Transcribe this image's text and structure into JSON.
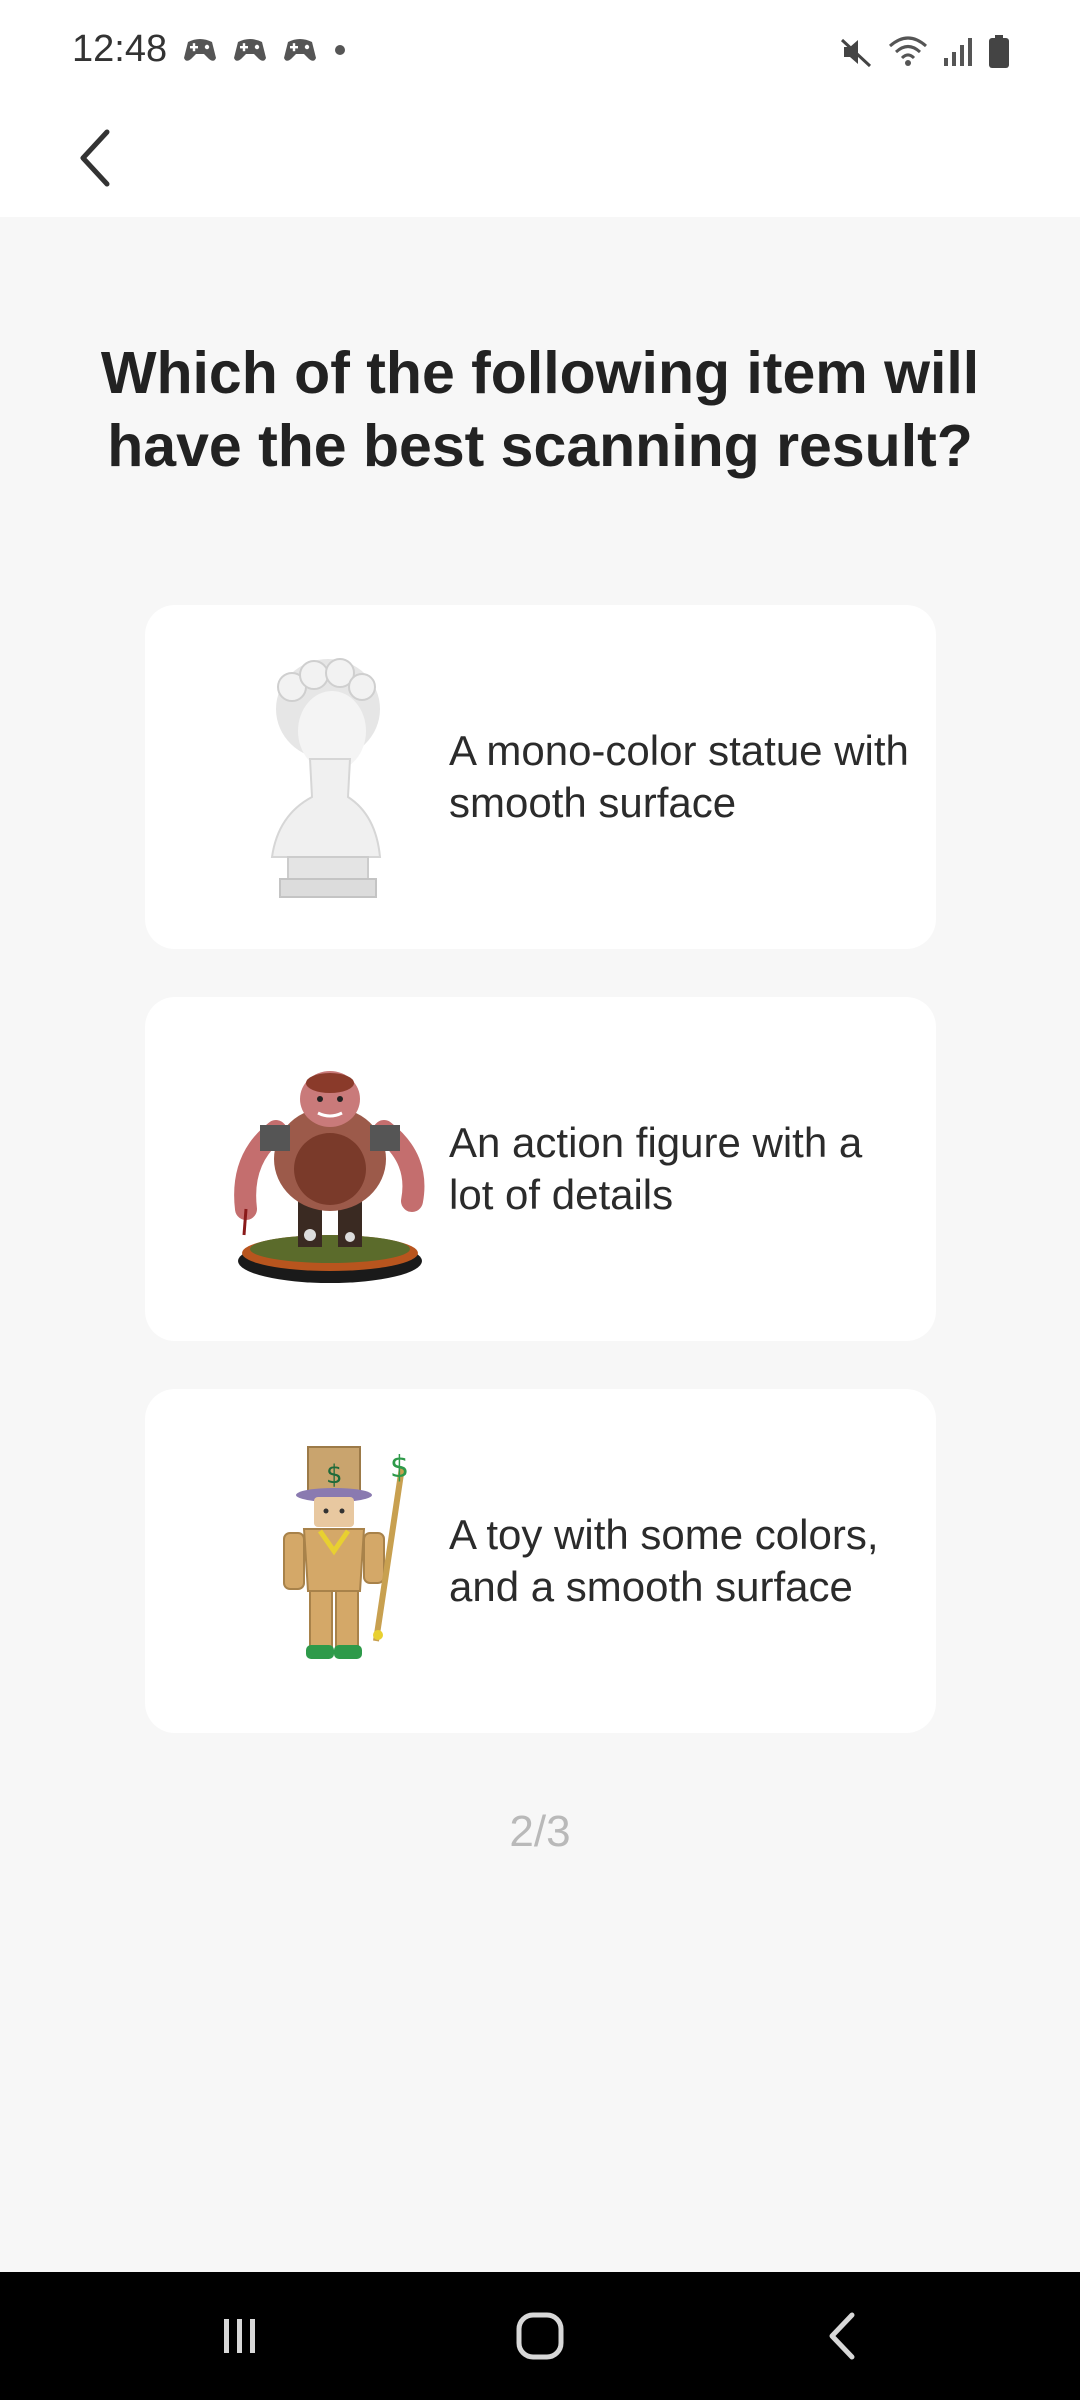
{
  "status_bar": {
    "time": "12:48",
    "left_icons": [
      "game-controller-icon",
      "game-controller-icon",
      "game-controller-icon",
      "dot-icon"
    ],
    "right_icons": [
      "mute-icon",
      "wifi-icon",
      "signal-icon",
      "battery-icon"
    ]
  },
  "header": {
    "back_icon": "chevron-left-icon"
  },
  "quiz": {
    "question": "Which of the following item will have the best scanning result?",
    "options": [
      {
        "label": "A mono-color statue with smooth surface",
        "image": "white-bust-statue"
      },
      {
        "label": "An action figure with a lot of details",
        "image": "detailed-ogre-figure"
      },
      {
        "label": "A toy with some colors, and a smooth surface",
        "image": "tophat-toy-figure"
      }
    ],
    "page_indicator": "2/3"
  },
  "nav_bar": {
    "buttons": [
      "recent-apps-icon",
      "home-icon",
      "back-icon"
    ]
  },
  "colors": {
    "background": "#f7f7f7",
    "card": "#ffffff",
    "text": "#222222",
    "muted": "#b9b9b9",
    "nav_bar": "#000000"
  }
}
